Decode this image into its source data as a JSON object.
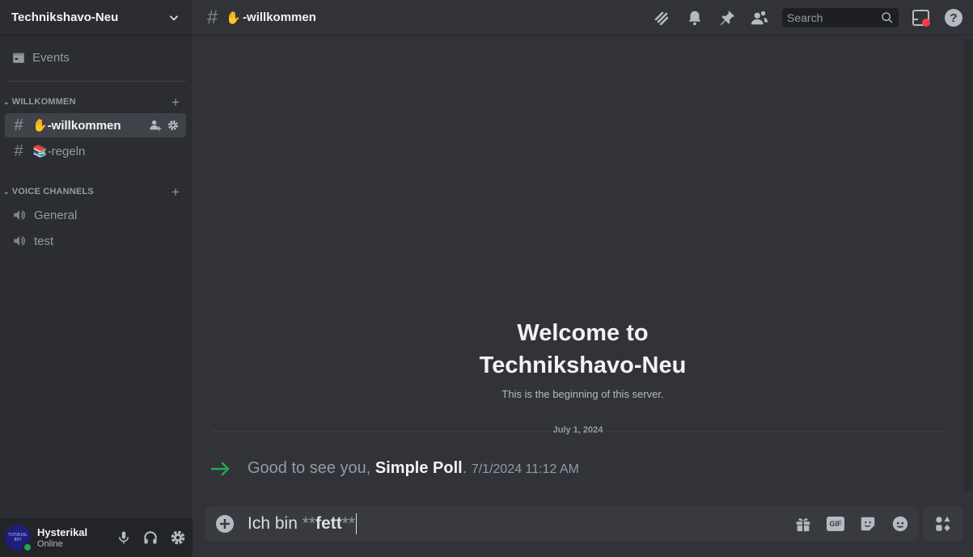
{
  "server": {
    "name": "Technikshavo-Neu",
    "menu_icon": "chevron-down-icon"
  },
  "sidebar": {
    "events_label": "Events",
    "categories": [
      {
        "name": "WILLKOMMEN",
        "channels": [
          {
            "emoji": "✋",
            "name": "-willkommen",
            "type": "text",
            "active": true
          },
          {
            "emoji": "📚",
            "name": "-regeln",
            "type": "text",
            "active": false
          }
        ]
      },
      {
        "name": "VOICE CHANNELS",
        "channels": [
          {
            "name": "General",
            "type": "voice"
          },
          {
            "name": "test",
            "type": "voice"
          }
        ]
      }
    ]
  },
  "user": {
    "name": "Hysterikal",
    "status": "Online",
    "avatar_text_top": "TUTORIAL",
    "avatar_text_bottom": "BOY",
    "status_color": "#23a55a"
  },
  "channel_header": {
    "emoji": "✋",
    "name": "-willkommen",
    "search_placeholder": "Search",
    "icons": [
      "threads-icon",
      "bell-icon",
      "pin-icon",
      "members-icon",
      "inbox-icon",
      "help-icon"
    ]
  },
  "welcome": {
    "title_line1": "Welcome to",
    "title_line2": "Technikshavo-Neu",
    "subtitle": "This is the beginning of this server."
  },
  "messages": {
    "date_divider": "July 1, 2024",
    "system": {
      "prefix": "Good to see you, ",
      "user": "Simple Poll",
      "suffix": ".",
      "timestamp": "7/1/2024 11:12 AM"
    }
  },
  "composer": {
    "text_plain": "Ich bin ",
    "md_open": "**",
    "text_bold": "fett",
    "md_close": "**",
    "gif_label": "GIF"
  },
  "colors": {
    "accent_green": "#23a55a",
    "notification_red": "#f23f43"
  }
}
